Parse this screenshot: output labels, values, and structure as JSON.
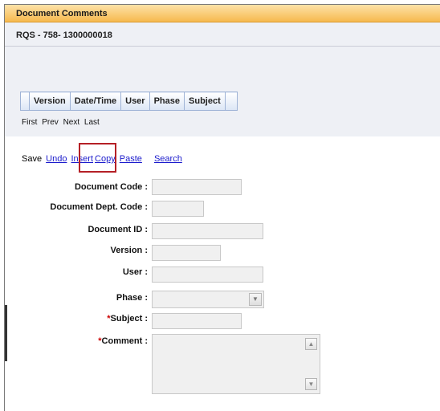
{
  "window": {
    "title": "Document Comments"
  },
  "document": {
    "header": "RQS - 758- 1300000018"
  },
  "grid": {
    "columns": [
      "Version",
      "Date/Time",
      "User",
      "Phase",
      "Subject"
    ]
  },
  "pager": {
    "first": "First",
    "prev": "Prev",
    "next": "Next",
    "last": "Last"
  },
  "toolbar": {
    "save": "Save",
    "undo": "Undo",
    "insert": "Insert",
    "copy": "Copy",
    "paste": "Paste",
    "search": "Search"
  },
  "form": {
    "document_code_label": "Document Code :",
    "document_dept_code_label": "Document Dept. Code :",
    "document_id_label": "Document ID :",
    "version_label": "Version :",
    "user_label": "User :",
    "phase_label": "Phase :",
    "subject_label": "Subject :",
    "comment_label": "Comment :",
    "required_marker": "*"
  },
  "colors": {
    "title_bar": "#f6b94e",
    "panel": "#eef0f5",
    "link": "#1a1acc",
    "highlight_box": "#b52026",
    "required": "#cc0000"
  },
  "icons": {
    "select_arrow": "chevron-down-icon",
    "scroll_up": "chevron-up-icon",
    "scroll_down": "chevron-down-icon"
  }
}
